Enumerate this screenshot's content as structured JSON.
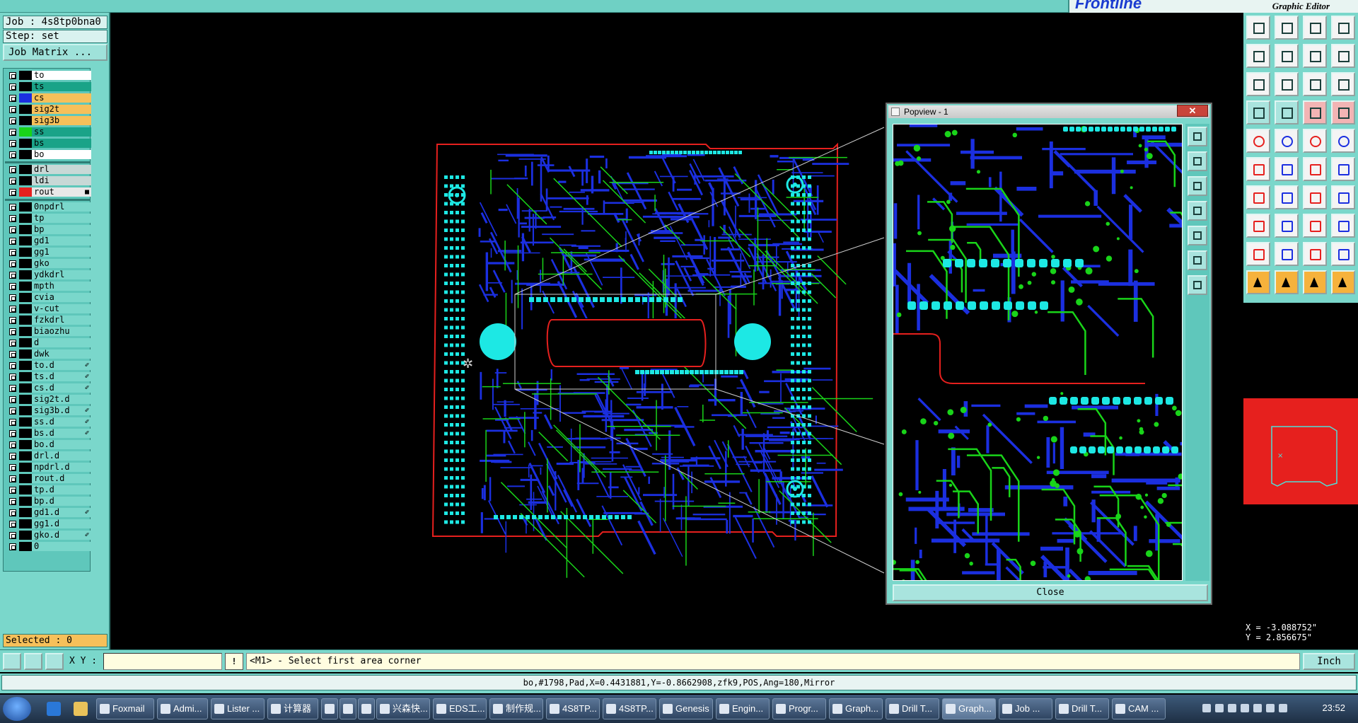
{
  "app": {
    "brand": "Frontline",
    "title": "Graphic Editor"
  },
  "job": {
    "job_line": "Job : 4s8tp0bna0",
    "step_line": "Step: set",
    "matrix_button": "Job Matrix ..."
  },
  "layers": [
    {
      "name": "to",
      "swatch": "#000000",
      "bg": "#ffffff"
    },
    {
      "name": "ts",
      "swatch": "#000000",
      "bg": "#1aa388"
    },
    {
      "name": "cs",
      "swatch": "#1b2fe0",
      "bg": "#f6c05a"
    },
    {
      "name": "sig2t",
      "swatch": "#000000",
      "bg": "#f6c05a"
    },
    {
      "name": "sig3b",
      "swatch": "#000000",
      "bg": "#f6c05a"
    },
    {
      "name": "ss",
      "swatch": "#19d419",
      "bg": "#1aa388"
    },
    {
      "name": "bs",
      "swatch": "#000000",
      "bg": "#1aa388"
    },
    {
      "name": "bo",
      "swatch": "#000000",
      "bg": "#ffffff"
    },
    {
      "name": "drl",
      "swatch": "#000000",
      "bg": "#c8d8d6"
    },
    {
      "name": "ldi",
      "swatch": "#000000",
      "bg": "#c8d8d6"
    },
    {
      "name": "rout",
      "swatch": "#e6201e",
      "bg": "#e8e8e8",
      "tag": "■"
    },
    {
      "name": "0npdrl",
      "swatch": "#000000",
      "bg": "#7ad7cb"
    },
    {
      "name": "tp",
      "swatch": "#000000",
      "bg": "#7ad7cb"
    },
    {
      "name": "bp",
      "swatch": "#000000",
      "bg": "#7ad7cb"
    },
    {
      "name": "gd1",
      "swatch": "#000000",
      "bg": "#7ad7cb"
    },
    {
      "name": "gg1",
      "swatch": "#000000",
      "bg": "#7ad7cb"
    },
    {
      "name": "gko",
      "swatch": "#000000",
      "bg": "#7ad7cb"
    },
    {
      "name": "ydkdrl",
      "swatch": "#000000",
      "bg": "#7ad7cb"
    },
    {
      "name": "mpth",
      "swatch": "#000000",
      "bg": "#7ad7cb"
    },
    {
      "name": "cvia",
      "swatch": "#000000",
      "bg": "#7ad7cb"
    },
    {
      "name": "v-cut",
      "swatch": "#000000",
      "bg": "#7ad7cb"
    },
    {
      "name": "fzkdrl",
      "swatch": "#000000",
      "bg": "#7ad7cb"
    },
    {
      "name": "biaozhu",
      "swatch": "#000000",
      "bg": "#7ad7cb"
    },
    {
      "name": "d",
      "swatch": "#000000",
      "bg": "#7ad7cb"
    },
    {
      "name": "dwk",
      "swatch": "#000000",
      "bg": "#7ad7cb"
    },
    {
      "name": "to.d",
      "swatch": "#000000",
      "bg": "#7ad7cb",
      "tag": "✐"
    },
    {
      "name": "ts.d",
      "swatch": "#000000",
      "bg": "#7ad7cb",
      "tag": "✐"
    },
    {
      "name": "cs.d",
      "swatch": "#000000",
      "bg": "#7ad7cb",
      "tag": "✐"
    },
    {
      "name": "sig2t.d",
      "swatch": "#000000",
      "bg": "#7ad7cb"
    },
    {
      "name": "sig3b.d",
      "swatch": "#000000",
      "bg": "#7ad7cb",
      "tag": "✐"
    },
    {
      "name": "ss.d",
      "swatch": "#000000",
      "bg": "#7ad7cb",
      "tag": "✐"
    },
    {
      "name": "bs.d",
      "swatch": "#000000",
      "bg": "#7ad7cb",
      "tag": "✐"
    },
    {
      "name": "bo.d",
      "swatch": "#000000",
      "bg": "#7ad7cb"
    },
    {
      "name": "drl.d",
      "swatch": "#000000",
      "bg": "#7ad7cb"
    },
    {
      "name": "npdrl.d",
      "swatch": "#000000",
      "bg": "#7ad7cb"
    },
    {
      "name": "rout.d",
      "swatch": "#000000",
      "bg": "#7ad7cb"
    },
    {
      "name": "tp.d",
      "swatch": "#000000",
      "bg": "#7ad7cb"
    },
    {
      "name": "bp.d",
      "swatch": "#000000",
      "bg": "#7ad7cb"
    },
    {
      "name": "gd1.d",
      "swatch": "#000000",
      "bg": "#7ad7cb",
      "tag": "✐"
    },
    {
      "name": "gg1.d",
      "swatch": "#000000",
      "bg": "#7ad7cb"
    },
    {
      "name": "gko.d",
      "swatch": "#000000",
      "bg": "#7ad7cb",
      "tag": "✐"
    },
    {
      "name": "0",
      "swatch": "#000000",
      "bg": "#7ad7cb"
    }
  ],
  "selected": "Selected : 0",
  "popview": {
    "title": "Popview - 1",
    "close_x": "✕",
    "close_button": "Close"
  },
  "coords": {
    "x": "X = -3.088752\"",
    "y": "Y = 2.856675\""
  },
  "command": {
    "xy_label": "X Y :",
    "xy_value": "",
    "warn": "!",
    "prompt": "<M1> - Select first area corner",
    "units": "Inch"
  },
  "info": "bo,#1798,Pad,X=0.4431881,Y=-0.8662908,zfk9,POS,Ang=180,Mirror",
  "taskbar": {
    "tasks": [
      "Foxmail",
      "Admi...",
      "Lister ...",
      "计算器",
      "",
      "",
      "",
      "兴森快...",
      "EDS工...",
      "制作规...",
      "4S8TP...",
      "4S8TP...",
      "Genesis",
      "Engin...",
      "Progr...",
      "Graph...",
      "Drill T...",
      "Graph...",
      "Job ...",
      "Drill T...",
      "CAM ..."
    ],
    "clock": "23:52"
  },
  "colors": {
    "panel": "#7ad7cb",
    "trace_blue": "#1b2fe0",
    "trace_green": "#19d419",
    "pad_cyan": "#1de8e4",
    "rout_red": "#e6201e"
  }
}
